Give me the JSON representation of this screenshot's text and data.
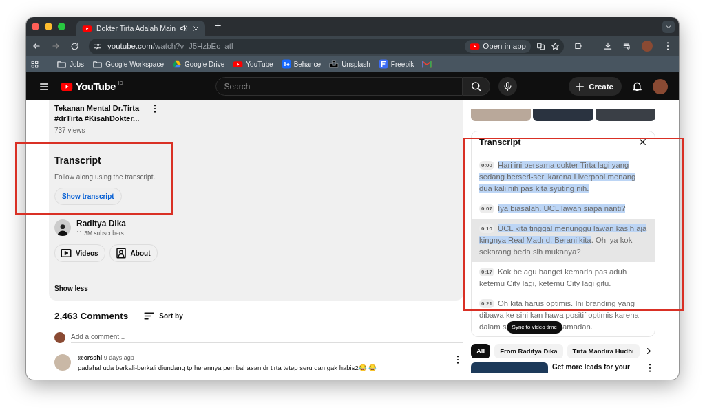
{
  "browser": {
    "tabs": [
      {
        "title": "Dokter Tirta Adalah Main",
        "selected": true
      }
    ],
    "url_host": "youtube.com",
    "url_path": "/watch?v=J5HzbEc_atl",
    "open_in_app": "Open in app",
    "bookmarks": [
      {
        "label": "Jobs",
        "kind": "folder"
      },
      {
        "label": "Google Workspace",
        "kind": "folder"
      },
      {
        "label": "Google Drive",
        "kind": "drive"
      },
      {
        "label": "YouTube",
        "kind": "youtube"
      },
      {
        "label": "Behance",
        "kind": "behance"
      },
      {
        "label": "Unsplash",
        "kind": "unsplash"
      },
      {
        "label": "Freepik",
        "kind": "freepik"
      },
      {
        "kind": "gmail"
      }
    ]
  },
  "masthead": {
    "logo": "YouTube",
    "region": "ID",
    "search_placeholder": "Search",
    "create": "Create"
  },
  "video": {
    "title": "Tekanan Mental Dr.Tirta #drTirta #KisahDokter...",
    "views": "737 views"
  },
  "transcript_card": {
    "title": "Transcript",
    "text": "Follow along using the transcript.",
    "button": "Show transcript"
  },
  "channel": {
    "name": "Raditya Dika",
    "subscribers": "11.3M subscribers",
    "buttons": [
      {
        "label": "Videos",
        "kind": "videos"
      },
      {
        "label": "About",
        "kind": "about"
      }
    ]
  },
  "show_less": "Show less",
  "comments": {
    "count": "2,463 Comments",
    "sort": "Sort by",
    "placeholder": "Add a comment...",
    "items": [
      {
        "author": "@crsshl",
        "time": "9 days ago",
        "text": "padahal uda berkali-berkali diundang tp herannya pembahasan dr tirta tetep seru dan gak habis2😂 😂"
      }
    ]
  },
  "transcript": {
    "title": "Transcript",
    "tooltip": "Sync to video time",
    "segments": [
      {
        "time": "0:00",
        "selected_text": "Hari ini bersama dokter Tirta lagi yang sedang berseri-seri karena Liverpool menang dua kali nih pas kita syuting nih.",
        "active": false
      },
      {
        "time": "0:07",
        "selected_text": "Iya biasalah. UCL lawan siapa nanti?",
        "active": false
      },
      {
        "time": "0:10",
        "selected_text": "UCL kita tinggal menunggu lawan kasih aja kingnya Real Madrid. Berani kita",
        "text": ". Oh iya kok sekarang beda sih mukanya?",
        "active": true
      },
      {
        "time": "0:17",
        "text": "Kok belagu banget kemarin pas aduh ketemu City lagi, ketemu City lagi gitu.",
        "active": false
      },
      {
        "time": "0:21",
        "text": "Oh kita harus optimis. Ini branding yang dibawa ke sini kan hawa positif optimis karena dalam s",
        "text_after": "amadan.",
        "active": false
      }
    ]
  },
  "chips": [
    {
      "label": "All",
      "selected": true
    },
    {
      "label": "From Raditya Dika",
      "selected": false
    },
    {
      "label": "Tirta Mandira Hudhi",
      "selected": false
    }
  ],
  "ad": {
    "title": "Get more leads for your"
  }
}
